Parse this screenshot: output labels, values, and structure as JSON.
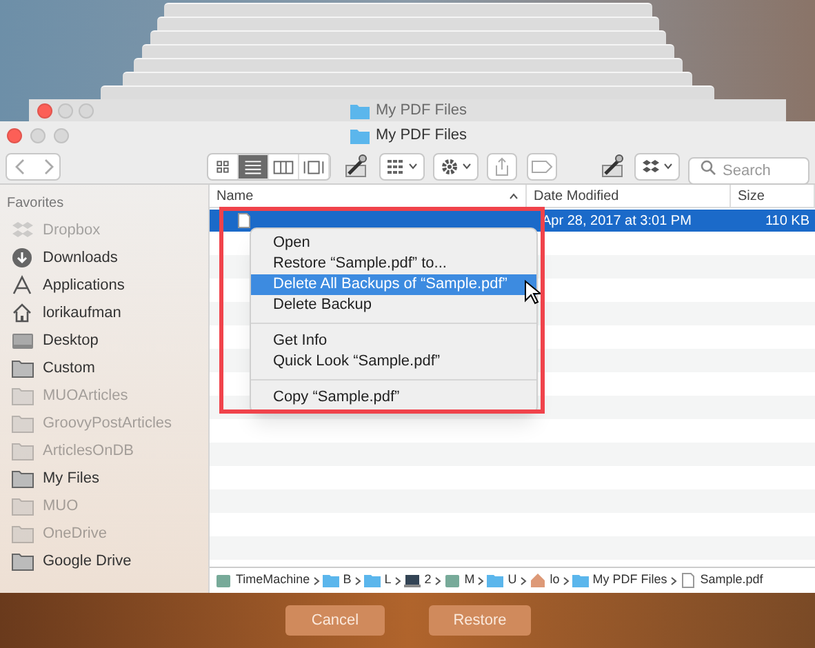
{
  "back_window": {
    "title": "My PDF Files"
  },
  "window": {
    "title": "My PDF Files"
  },
  "toolbar": {
    "search": {
      "placeholder": "Search"
    },
    "view_modes": [
      {
        "kind": "icons",
        "selected": false
      },
      {
        "kind": "list",
        "selected": true
      },
      {
        "kind": "columns",
        "selected": false
      },
      {
        "kind": "cover",
        "selected": false
      }
    ]
  },
  "sidebar": {
    "heading": "Favorites",
    "items": [
      {
        "label": "Dropbox",
        "kind": "dropbox",
        "disabled": true
      },
      {
        "label": "Downloads",
        "kind": "download",
        "disabled": false
      },
      {
        "label": "Applications",
        "kind": "apps",
        "disabled": false
      },
      {
        "label": "lorikaufman",
        "kind": "home",
        "disabled": false
      },
      {
        "label": "Desktop",
        "kind": "desktop",
        "disabled": false
      },
      {
        "label": "Custom",
        "kind": "folder",
        "disabled": false
      },
      {
        "label": "MUOArticles",
        "kind": "folder",
        "disabled": true
      },
      {
        "label": "GroovyPostArticles",
        "kind": "folder",
        "disabled": true
      },
      {
        "label": "ArticlesOnDB",
        "kind": "folder",
        "disabled": true
      },
      {
        "label": "My Files",
        "kind": "folder",
        "disabled": false
      },
      {
        "label": "MUO",
        "kind": "folder",
        "disabled": true
      },
      {
        "label": "OneDrive",
        "kind": "folder",
        "disabled": true
      },
      {
        "label": "Google Drive",
        "kind": "folder",
        "disabled": false
      }
    ]
  },
  "table": {
    "columns": [
      "Name",
      "Date Modified",
      "Size"
    ],
    "rows": [
      {
        "date": "Apr 28, 2017 at 3:01 PM",
        "size": "110 KB",
        "selected": true
      }
    ]
  },
  "context_menu": {
    "groups": [
      [
        {
          "label": "Open",
          "selected": false
        },
        {
          "label": "Restore “Sample.pdf” to...",
          "selected": false
        },
        {
          "label": "Delete All Backups of “Sample.pdf”",
          "selected": true
        },
        {
          "label": "Delete Backup",
          "selected": false
        }
      ],
      [
        {
          "label": "Get Info",
          "selected": false
        },
        {
          "label": "Quick Look “Sample.pdf”",
          "selected": false
        }
      ],
      [
        {
          "label": "Copy “Sample.pdf”",
          "selected": false
        }
      ]
    ]
  },
  "path_bar": [
    {
      "label": "TimeMachine",
      "kind": "disk"
    },
    {
      "label": "B",
      "kind": "folder"
    },
    {
      "label": "L",
      "kind": "folder"
    },
    {
      "label": "2",
      "kind": "computer"
    },
    {
      "label": "M",
      "kind": "disk"
    },
    {
      "label": "U",
      "kind": "folder"
    },
    {
      "label": "lo",
      "kind": "home"
    },
    {
      "label": "My PDF Files",
      "kind": "folder"
    },
    {
      "label": "Sample.pdf",
      "kind": "file"
    }
  ],
  "buttons": [
    "Cancel",
    "Restore"
  ]
}
